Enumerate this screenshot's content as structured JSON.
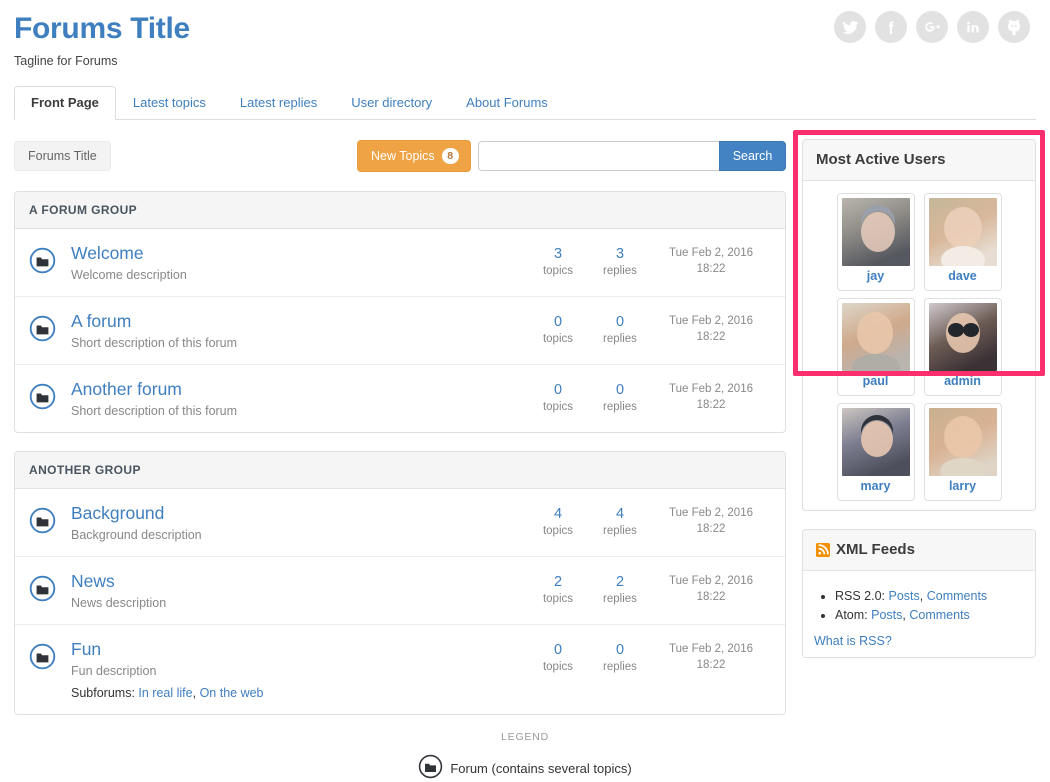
{
  "header": {
    "title": "Forums Title",
    "tagline": "Tagline for Forums",
    "social": [
      {
        "name": "twitter-icon",
        "label": "Twitter"
      },
      {
        "name": "facebook-icon",
        "label": "Facebook"
      },
      {
        "name": "google-plus-icon",
        "label": "Google Plus"
      },
      {
        "name": "linkedin-icon",
        "label": "LinkedIn"
      },
      {
        "name": "github-icon",
        "label": "GitHub"
      }
    ]
  },
  "tabs": [
    {
      "label": "Front Page",
      "active": true
    },
    {
      "label": "Latest topics",
      "active": false
    },
    {
      "label": "Latest replies",
      "active": false
    },
    {
      "label": "User directory",
      "active": false
    },
    {
      "label": "About Forums",
      "active": false
    }
  ],
  "toolbar": {
    "breadcrumb": "Forums Title",
    "new_topics_label": "New Topics",
    "new_topics_count": "8",
    "search_value": "",
    "search_placeholder": "",
    "search_button": "Search"
  },
  "groups": [
    {
      "title": "A FORUM GROUP",
      "forums": [
        {
          "title": "Welcome",
          "description": "Welcome description",
          "topics": "3",
          "topics_label": "topics",
          "replies": "3",
          "replies_label": "replies",
          "date": "Tue Feb 2, 2016",
          "time": "18:22",
          "subforums_label": "",
          "subforums": []
        },
        {
          "title": "A forum",
          "description": "Short description of this forum",
          "topics": "0",
          "topics_label": "topics",
          "replies": "0",
          "replies_label": "replies",
          "date": "Tue Feb 2, 2016",
          "time": "18:22",
          "subforums_label": "",
          "subforums": []
        },
        {
          "title": "Another forum",
          "description": "Short description of this forum",
          "topics": "0",
          "topics_label": "topics",
          "replies": "0",
          "replies_label": "replies",
          "date": "Tue Feb 2, 2016",
          "time": "18:22",
          "subforums_label": "",
          "subforums": []
        }
      ]
    },
    {
      "title": "ANOTHER GROUP",
      "forums": [
        {
          "title": "Background",
          "description": "Background description",
          "topics": "4",
          "topics_label": "topics",
          "replies": "4",
          "replies_label": "replies",
          "date": "Tue Feb 2, 2016",
          "time": "18:22",
          "subforums_label": "",
          "subforums": []
        },
        {
          "title": "News",
          "description": "News description",
          "topics": "2",
          "topics_label": "topics",
          "replies": "2",
          "replies_label": "replies",
          "date": "Tue Feb 2, 2016",
          "time": "18:22",
          "subforums_label": "",
          "subforums": []
        },
        {
          "title": "Fun",
          "description": "Fun description",
          "topics": "0",
          "topics_label": "topics",
          "replies": "0",
          "replies_label": "replies",
          "date": "Tue Feb 2, 2016",
          "time": "18:22",
          "subforums_label": "Subforums:",
          "subforums": [
            "In real life",
            "On the web"
          ]
        }
      ]
    }
  ],
  "sidebar": {
    "active_users": {
      "title": "Most Active Users",
      "users": [
        {
          "name": "jay",
          "avatar_colors": [
            "#b9b5ae",
            "#8e8b86",
            "#55585f"
          ]
        },
        {
          "name": "dave",
          "avatar_colors": [
            "#c5b79a",
            "#d8b79b",
            "#e7ddd2"
          ]
        },
        {
          "name": "paul",
          "avatar_colors": [
            "#ddd6c8",
            "#cfa98c",
            "#b9b4ae"
          ]
        },
        {
          "name": "admin",
          "avatar_colors": [
            "#cfc9cd",
            "#6d5c55",
            "#3b3236"
          ]
        },
        {
          "name": "mary",
          "avatar_colors": [
            "#cdc6c1",
            "#7d7f91",
            "#4e4f5c"
          ]
        },
        {
          "name": "larry",
          "avatar_colors": [
            "#c7b190",
            "#d9b294",
            "#ded3c4"
          ]
        }
      ]
    },
    "xml_feeds": {
      "title": "XML Feeds",
      "items": [
        {
          "label": "RSS 2.0:",
          "links": [
            "Posts",
            "Comments"
          ]
        },
        {
          "label": "Atom:",
          "links": [
            "Posts",
            "Comments"
          ]
        }
      ],
      "what_is_rss": "What is RSS?"
    }
  },
  "legend": {
    "title": "LEGEND",
    "text": "Forum (contains several topics)"
  },
  "colors": {
    "link": "#3f7fbf",
    "accent_orange": "#efa344",
    "search_blue": "#4383c4",
    "highlight_pink": "#fb2e6e",
    "rss_orange": "#f29100"
  }
}
